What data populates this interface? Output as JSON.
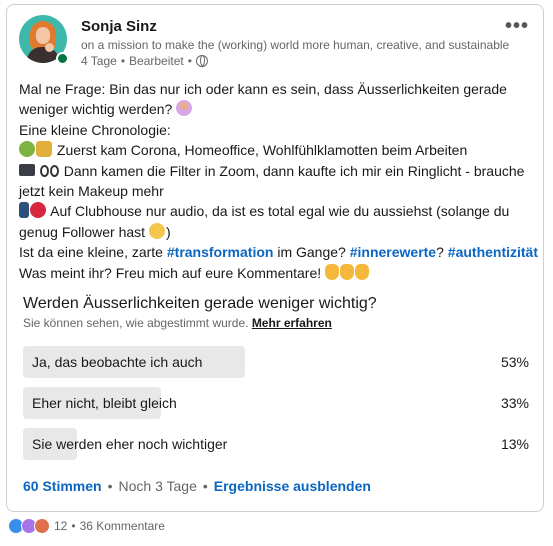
{
  "author": {
    "name": "Sonja Sinz",
    "tagline": "on a mission to make the (working) world more human, creative, and sustainable",
    "time": "4 Tage",
    "edited": "Bearbeitet",
    "presence_color": "#057642"
  },
  "post": {
    "line1": "Mal ne Frage: Bin das nur ich oder kann es sein, dass Äusserlichkeiten gerade",
    "line2": "weniger wichtig werden?",
    "line3": "Eine kleine Chronologie:",
    "line4": "Zuerst kam Corona, Homeoffice, Wohlfühlklamotten beim Arbeiten",
    "line5": "Dann kamen die Filter in Zoom, dann kaufte ich mir ein Ringlicht - brauche",
    "line6": "jetzt kein Makeup mehr",
    "line7": "Auf Clubhouse nur audio, da ist es total egal wie du aussiehst (solange du",
    "line8": "genug Follower hast",
    "line9_pre": "Ist da eine kleine, zarte",
    "hashtag1": "#transformation",
    "line9_mid": "im Gange?",
    "hashtag2": "#innerewerte",
    "line9_q": "?",
    "hashtag3": "#authentizität",
    "line10": "Was meint ihr? Freu mich auf eure Kommentare!",
    "emoji_icons": [
      "person-raising-hand-icon",
      "virus-icon",
      "lock-icon",
      "laptop-icon",
      "eyes-icon",
      "mobile-phone-icon",
      "telephone-icon",
      "smirk-face-icon",
      "pointing-down-icon"
    ]
  },
  "poll": {
    "question": "Werden Äusserlichkeiten gerade weniger wichtig?",
    "subtitle": "Sie können sehen, wie abgestimmt wurde.",
    "learn_more": "Mehr erfahren",
    "options": [
      {
        "label": "Ja, das beobachte ich auch",
        "percent_text": "53%",
        "percent": 53
      },
      {
        "label": "Eher nicht, bleibt gleich",
        "percent_text": "33%",
        "percent": 33
      },
      {
        "label": "Sie werden eher noch wichtiger",
        "percent_text": "13%",
        "percent": 13
      }
    ],
    "votes": "60 Stimmen",
    "remaining": "Noch 3 Tage",
    "hide_results": "Ergebnisse ausblenden",
    "bar_color": "#e8e8e8"
  },
  "social": {
    "reactions": [
      "like-icon",
      "curious-icon",
      "love-icon"
    ],
    "count": "12",
    "comments": "36 Kommentare"
  },
  "colors": {
    "link": "#0a66c2",
    "text": "#191919",
    "muted": "#666666"
  }
}
